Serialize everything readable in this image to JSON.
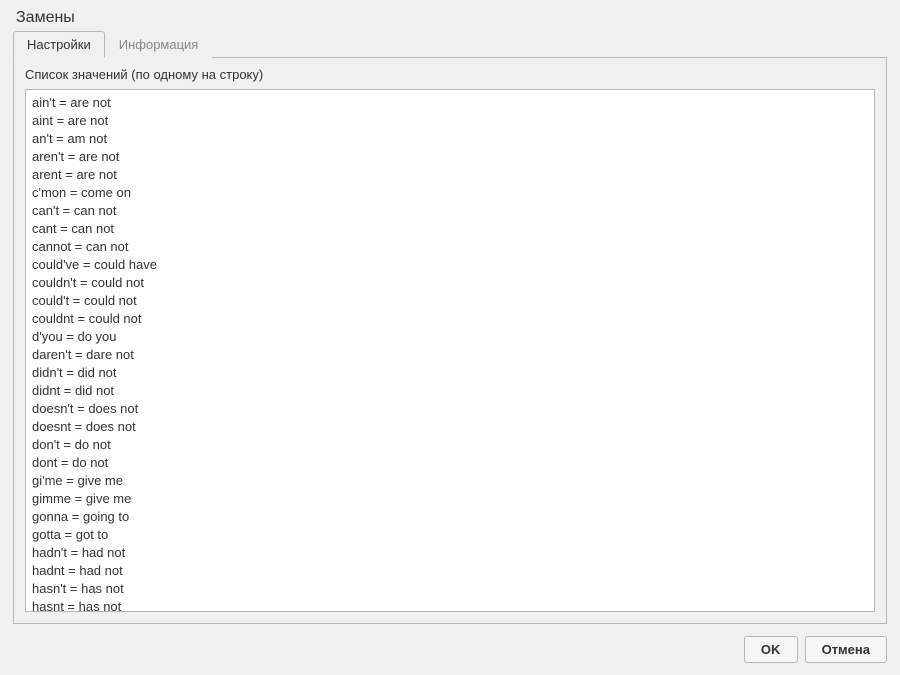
{
  "window": {
    "title": "Замены"
  },
  "tabs": [
    {
      "label": "Настройки"
    },
    {
      "label": "Информация"
    }
  ],
  "form": {
    "list_label": "Список значений (по одному на строку)",
    "values": "ain't = are not\naint = are not\nan't = am not\naren't = are not\narent = are not\nc'mon = come on\ncan't = can not\ncant = can not\ncannot = can not\ncould've = could have\ncouldn't = could not\ncould't = could not\ncouldnt = could not\nd'you = do you\ndaren't = dare not\ndidn't = did not\ndidnt = did not\ndoesn't = does not\ndoesnt = does not\ndon't = do not\ndont = do not\ngi'me = give me\ngimme = give me\ngonna = going to\ngotta = got to\nhadn't = had not\nhadnt = had not\nhasn't = has not\nhasnt = has not"
  },
  "buttons": {
    "ok": "OK",
    "cancel": "Отмена"
  }
}
